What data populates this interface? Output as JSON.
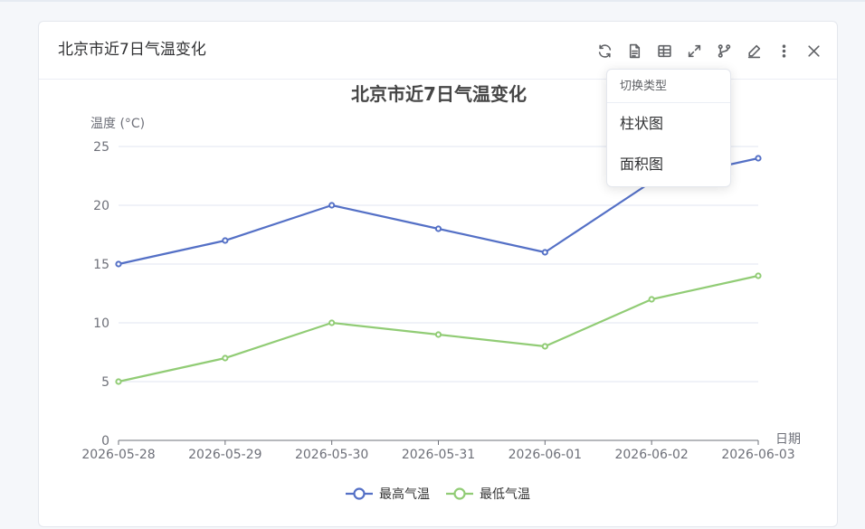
{
  "card": {
    "title": "北京市近7日气温变化"
  },
  "toolbar": {
    "icons": [
      "refresh-icon",
      "document-icon",
      "table-icon",
      "fullscreen-icon",
      "chart-switch-icon",
      "edit-icon",
      "more-vertical-icon",
      "close-icon"
    ]
  },
  "dropdown": {
    "header": "切换类型",
    "items": [
      "柱状图",
      "面积图"
    ]
  },
  "chart_data": {
    "type": "line",
    "title": "北京市近7日气温变化",
    "xlabel": "日期",
    "ylabel": "温度 (°C)",
    "categories": [
      "2026-05-28",
      "2026-05-29",
      "2026-05-30",
      "2026-05-31",
      "2026-06-01",
      "2026-06-02",
      "2026-06-03"
    ],
    "ylim": [
      0,
      25
    ],
    "yticks": [
      0,
      5,
      10,
      15,
      20,
      25
    ],
    "grid": true,
    "legend_position": "bottom",
    "series": [
      {
        "name": "最高气温",
        "values": [
          15,
          17,
          20,
          18,
          16,
          22,
          24
        ],
        "color": "#5470c6"
      },
      {
        "name": "最低气温",
        "values": [
          5,
          7,
          10,
          9,
          8,
          12,
          14
        ],
        "color": "#91cc75"
      }
    ]
  }
}
